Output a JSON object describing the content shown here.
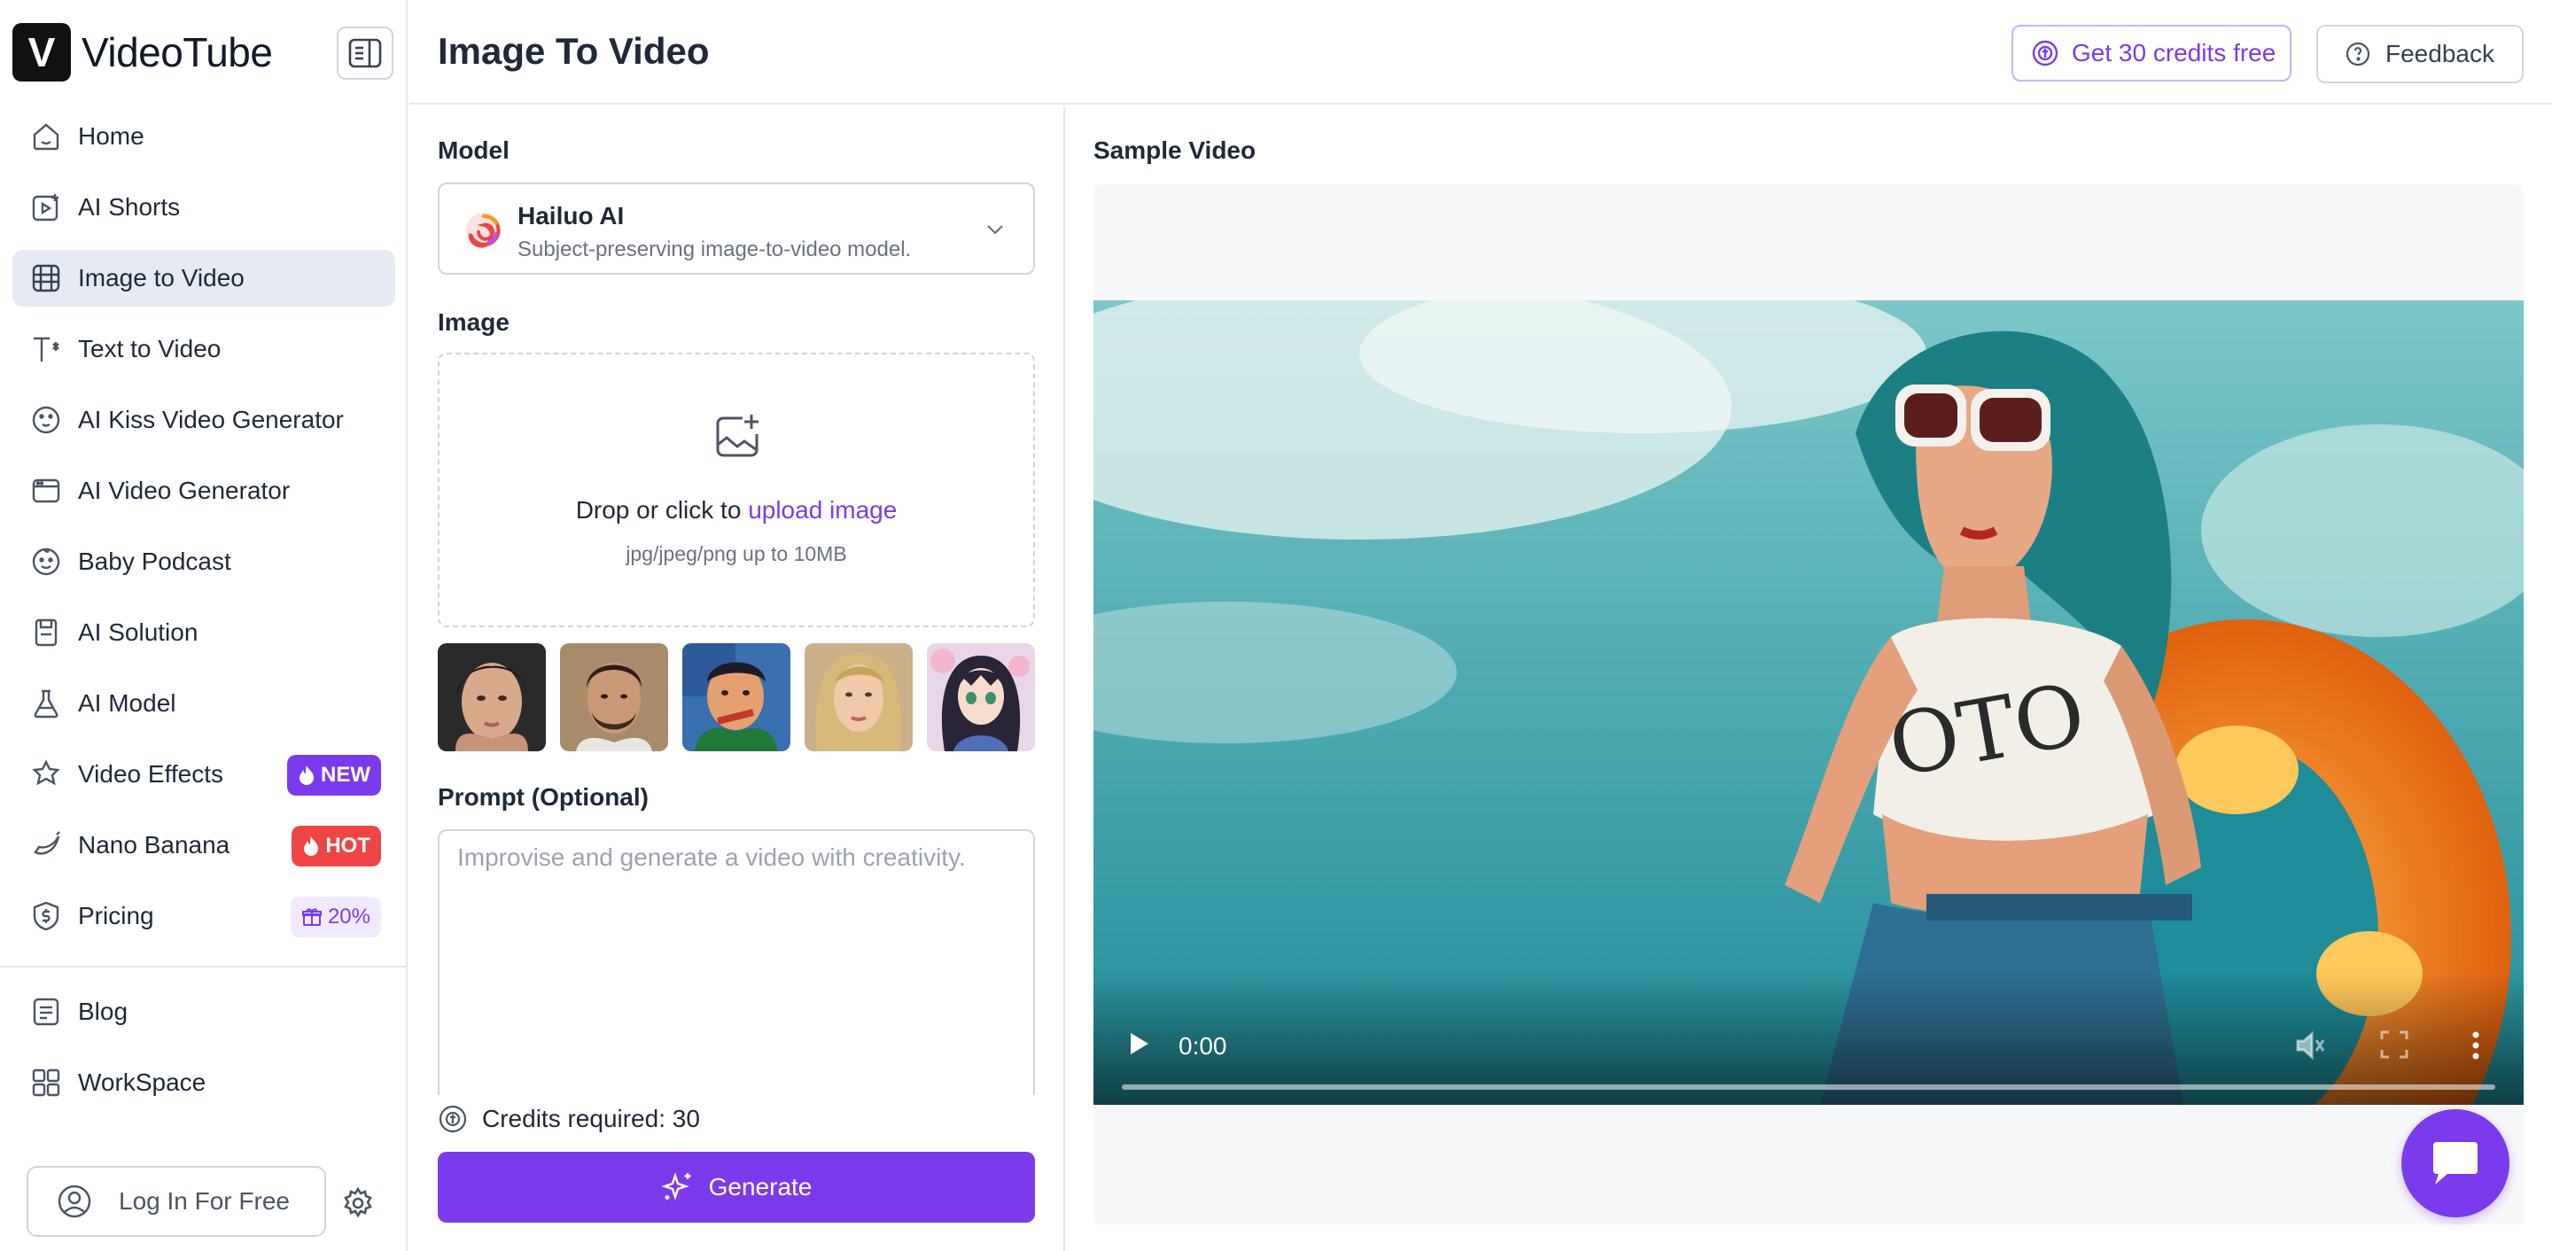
{
  "app": {
    "brand_letter": "V",
    "brand_name": "VideoTube"
  },
  "sidebar": {
    "items": [
      {
        "label": "Home",
        "icon": "home-icon"
      },
      {
        "label": "AI Shorts",
        "icon": "shorts-icon"
      },
      {
        "label": "Image to Video",
        "icon": "film-icon",
        "active": true
      },
      {
        "label": "Text to Video",
        "icon": "text-icon"
      },
      {
        "label": "AI Kiss Video Generator",
        "icon": "kiss-icon"
      },
      {
        "label": "AI Video Generator",
        "icon": "video-gen-icon"
      },
      {
        "label": "Baby Podcast",
        "icon": "baby-icon"
      },
      {
        "label": "AI Solution",
        "icon": "solution-icon"
      },
      {
        "label": "AI Model",
        "icon": "flask-icon"
      },
      {
        "label": "Video Effects",
        "icon": "effects-icon",
        "badge": "NEW"
      },
      {
        "label": "Nano Banana",
        "icon": "banana-icon",
        "badge": "HOT"
      },
      {
        "label": "Pricing",
        "icon": "dollar-icon",
        "badge": "20%"
      }
    ],
    "secondary": [
      {
        "label": "Blog",
        "icon": "blog-icon"
      },
      {
        "label": "WorkSpace",
        "icon": "workspace-icon"
      }
    ],
    "login_label": "Log In For Free"
  },
  "header": {
    "title": "Image To Video",
    "credits_button": "Get 30 credits free",
    "feedback_button": "Feedback"
  },
  "form": {
    "model_label": "Model",
    "model": {
      "name": "Hailuo AI",
      "description": "Subject-preserving image-to-video model."
    },
    "image_label": "Image",
    "upload": {
      "prefix": "Drop or click to ",
      "link": "upload image",
      "hint": "jpg/jpeg/png up to 10MB"
    },
    "sample_images": [
      "portrait-woman",
      "portrait-man",
      "painting-man",
      "portrait-blonde",
      "anime-girl"
    ],
    "prompt_label": "Prompt (Optional)",
    "prompt_placeholder": "Improvise and generate a video with creativity.",
    "prompt_value": "",
    "credits_required": "Credits required: 30",
    "generate_label": "Generate"
  },
  "sample": {
    "title": "Sample Video",
    "time": "0:00",
    "progress": 0
  },
  "colors": {
    "accent": "#7c3aed",
    "hot": "#ef4444",
    "active_bg": "#e6eaf2",
    "border": "#e5e7eb"
  }
}
